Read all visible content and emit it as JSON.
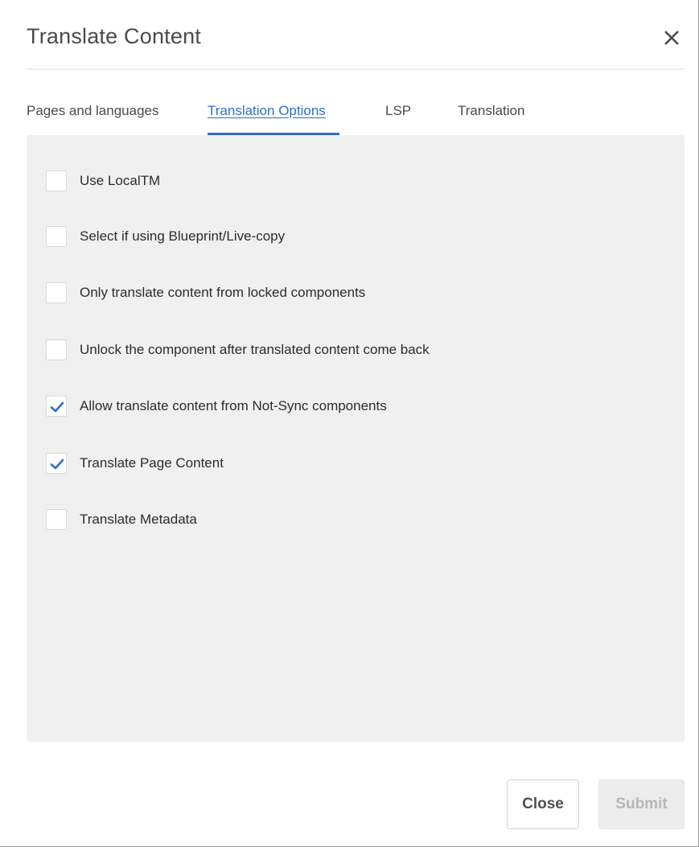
{
  "dialog": {
    "title": "Translate Content"
  },
  "tabs": [
    {
      "label": "Pages and languages",
      "active": false
    },
    {
      "label": "Translation Options",
      "active": true
    },
    {
      "label": "LSP",
      "active": false
    },
    {
      "label": "Translation",
      "active": false
    }
  ],
  "options": [
    {
      "label": "Use LocalTM",
      "checked": false
    },
    {
      "label": "Select if using Blueprint/Live-copy",
      "checked": false
    },
    {
      "label": "Only translate content from locked components",
      "checked": false
    },
    {
      "label": "Unlock the component after translated content come back",
      "checked": false
    },
    {
      "label": "Allow translate content from Not-Sync components",
      "checked": true
    },
    {
      "label": "Translate Page Content",
      "checked": true
    },
    {
      "label": "Translate Metadata",
      "checked": false
    }
  ],
  "footer": {
    "close_label": "Close",
    "submit_label": "Submit",
    "submit_enabled": false
  },
  "colors": {
    "accent": "#2d6fc9",
    "panel_bg": "#f0f0f0"
  },
  "icons": {
    "close": "close-icon",
    "check": "checkmark-icon"
  }
}
